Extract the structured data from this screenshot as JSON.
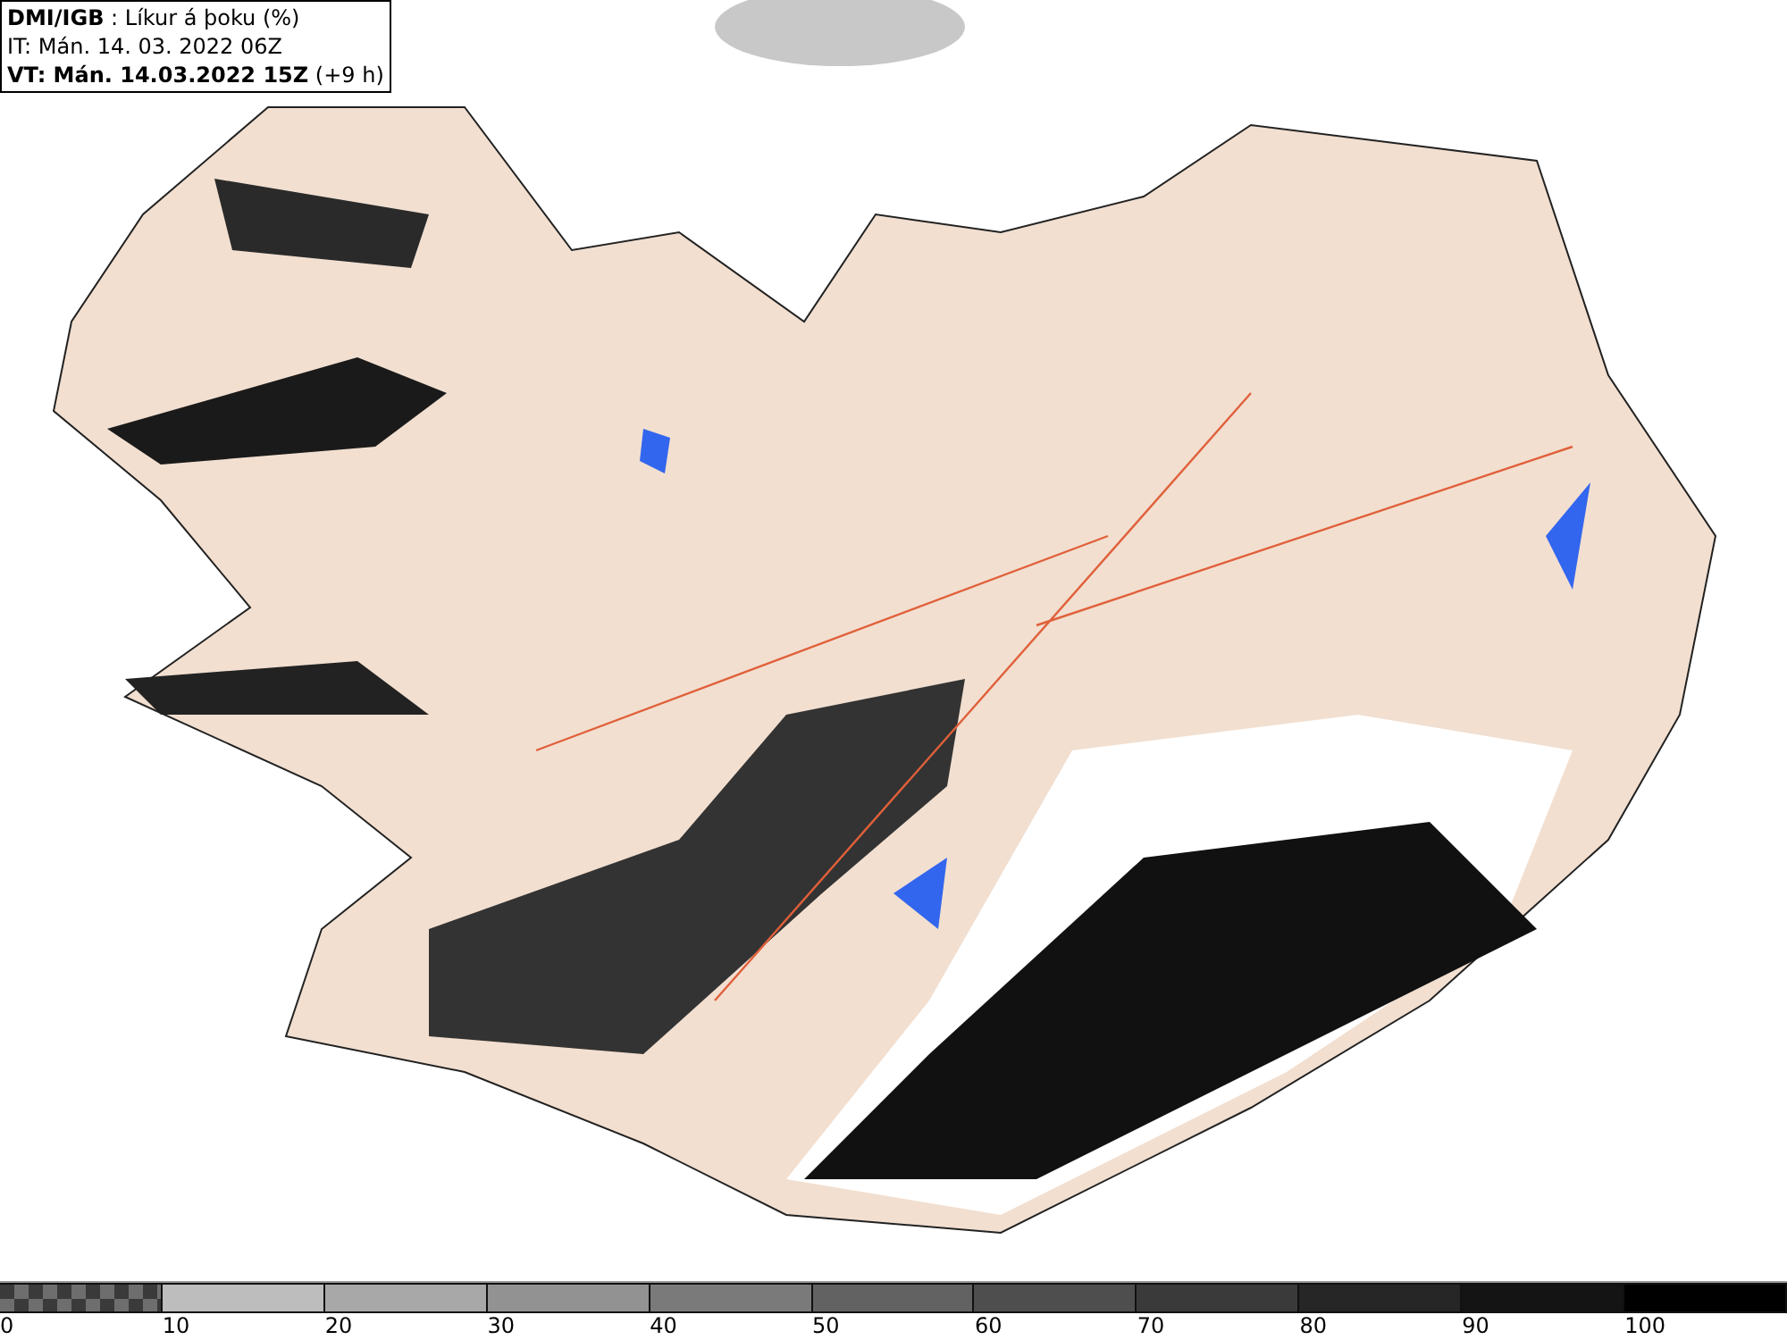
{
  "header": {
    "lines": [
      "**DMI/IGB** : Líkur á þoku (%)",
      "IT: Mán. 14. 03. 2022 06Z",
      "**VT: Mán. 14.03.2022 15Z** (+9 h)"
    ]
  },
  "legend": {
    "segments": [
      {
        "label": "0",
        "kind": "checker",
        "color": "#6e6e6e"
      },
      {
        "label": "10",
        "kind": "solid",
        "color": "#bdbdbd"
      },
      {
        "label": "20",
        "kind": "solid",
        "color": "#a8a8a8"
      },
      {
        "label": "30",
        "kind": "solid",
        "color": "#929292"
      },
      {
        "label": "40",
        "kind": "solid",
        "color": "#7a7a7a"
      },
      {
        "label": "50",
        "kind": "solid",
        "color": "#626262"
      },
      {
        "label": "60",
        "kind": "solid",
        "color": "#4e4e4e"
      },
      {
        "label": "70",
        "kind": "solid",
        "color": "#3a3a3a"
      },
      {
        "label": "80",
        "kind": "solid",
        "color": "#262626"
      },
      {
        "label": "90",
        "kind": "solid",
        "color": "#141414"
      },
      {
        "label": "100",
        "kind": "solid",
        "color": "#000000"
      }
    ]
  }
}
